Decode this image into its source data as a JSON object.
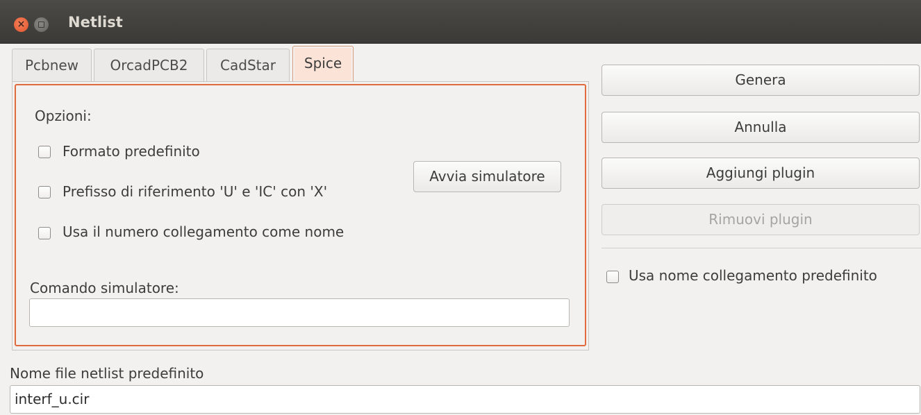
{
  "window": {
    "title": "Netlist"
  },
  "tabs": [
    "Pcbnew",
    "OrcadPCB2",
    "CadStar",
    "Spice"
  ],
  "spice_panel": {
    "options_label": "Opzioni:",
    "checkboxes": [
      {
        "label": "Formato predefinito",
        "checked": false
      },
      {
        "label": "Prefisso di riferimento 'U' e 'IC' con 'X'",
        "checked": false
      },
      {
        "label": "Usa il numero collegamento come nome",
        "checked": false
      }
    ],
    "run_simulator_button": "Avvia simulatore",
    "simulator_command_label": "Comando simulatore:",
    "simulator_command_value": ""
  },
  "actions": {
    "generate": "Genera",
    "cancel": "Annulla",
    "add_plugin": "Aggiungi plugin",
    "remove_plugin": "Rimuovi plugin",
    "use_default_net_name": "Usa nome collegamento predefinito"
  },
  "default_netlist": {
    "label": "Nome file netlist predefinito",
    "value": "interf_u.cir"
  }
}
